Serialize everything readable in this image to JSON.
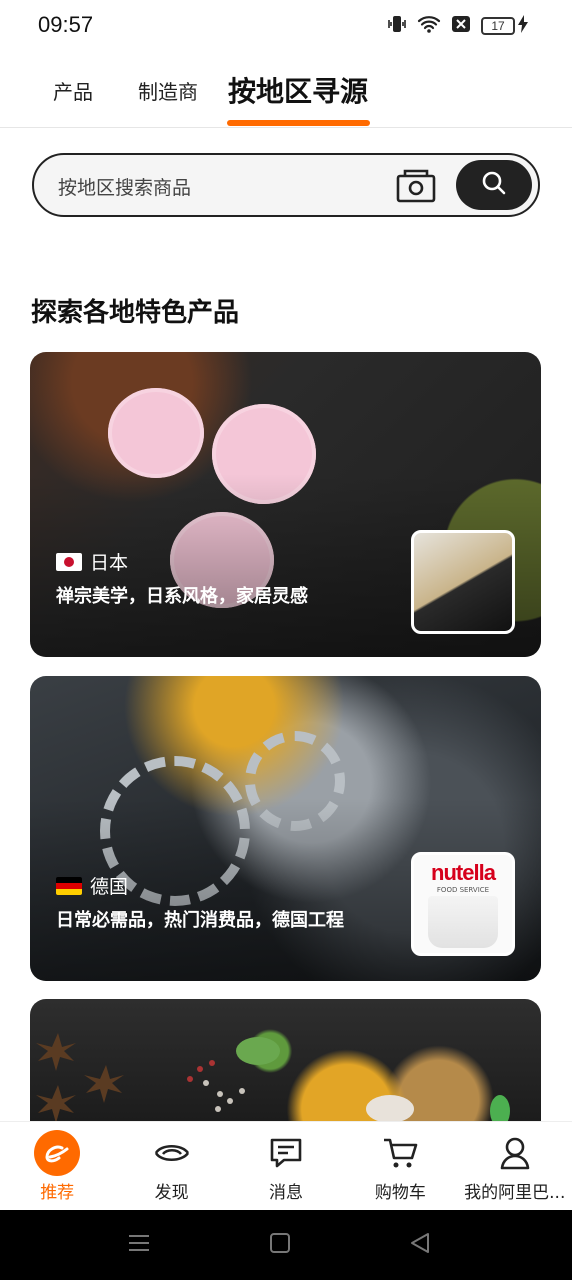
{
  "status_bar": {
    "time": "09:57",
    "battery_level": "17",
    "icons": [
      "vibrate-icon",
      "wifi-icon",
      "sim-blocked-icon",
      "battery-icon",
      "charging-icon"
    ]
  },
  "tabs": {
    "products": "产品",
    "manufacturers": "制造商",
    "region_sourcing": "按地区寻源",
    "active": "region_sourcing",
    "accent_color": "#ff6a00"
  },
  "search": {
    "placeholder": "按地区搜索商品",
    "icons": [
      "camera-icon",
      "search-icon"
    ]
  },
  "section": {
    "title": "探索各地特色产品"
  },
  "cards": [
    {
      "country": "日本",
      "flag": "japan-flag",
      "caption": "禅宗美学，日系风格，家居灵感",
      "thumbnail": "charcoal-powder"
    },
    {
      "country": "德国",
      "flag": "germany-flag",
      "caption": "日常必需品，热门消费品，德国工程",
      "thumbnail": "nutella-tub",
      "thumbnail_brand": "nutella",
      "thumbnail_subtext": "FOOD SERVICE"
    },
    {
      "country": "",
      "thumbnail": "spices"
    }
  ],
  "bottom_nav": {
    "items": [
      {
        "label": "推荐",
        "icon": "alibaba-logo-icon",
        "active": true
      },
      {
        "label": "发现",
        "icon": "discover-icon",
        "active": false
      },
      {
        "label": "消息",
        "icon": "message-icon",
        "active": false
      },
      {
        "label": "购物车",
        "icon": "cart-icon",
        "active": false
      },
      {
        "label": "我的阿里巴...",
        "icon": "user-icon",
        "active": false
      }
    ]
  },
  "system_nav": {
    "icons": [
      "menu-icon",
      "home-icon",
      "back-icon"
    ]
  }
}
